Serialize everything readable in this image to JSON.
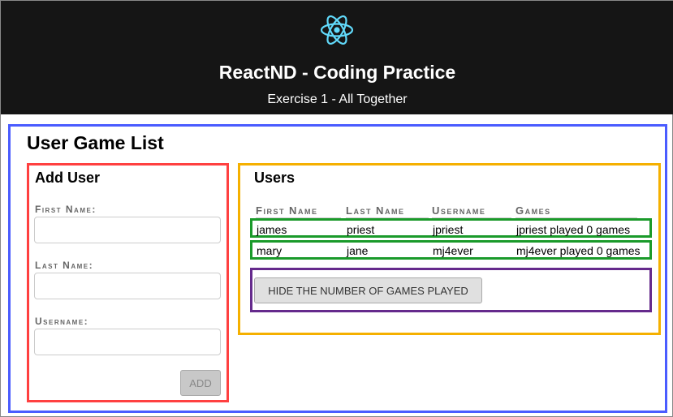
{
  "header": {
    "title": "ReactND - Coding Practice",
    "subtitle": "Exercise 1 - All Together",
    "logo_icon": "react-atom-icon",
    "logo_color": "#61dafb"
  },
  "page_title": "User Game List",
  "add_user": {
    "title": "Add User",
    "first_name_label": "First Name:",
    "last_name_label": "Last Name:",
    "username_label": "Username:",
    "first_name_value": "",
    "last_name_value": "",
    "username_value": "",
    "add_label": "ADD"
  },
  "users": {
    "title": "Users",
    "columns": [
      "First Name",
      "Last Name",
      "Username",
      "Games"
    ],
    "rows": [
      [
        "james",
        "priest",
        "jpriest",
        "jpriest played 0 games"
      ],
      [
        "mary",
        "jane",
        "mj4ever",
        "mj4ever played 0 games"
      ]
    ],
    "toggle_label": "HIDE THE NUMBER OF GAMES PLAYED"
  }
}
